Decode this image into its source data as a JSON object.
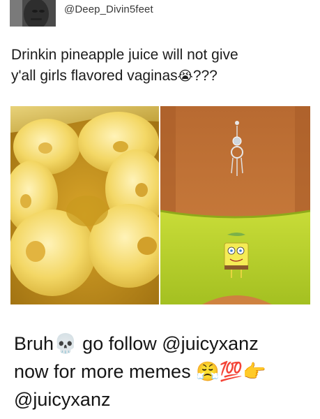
{
  "header": {
    "handle": "@Deep_Divin5feet"
  },
  "tweet": {
    "line1": "Drinkin pineapple juice will not give",
    "line2_text": "y'all girls flavored vaginas",
    "line2_emoji": "😭",
    "line2_suffix": "???"
  },
  "collage": {
    "left_image": "pineapple-rings-photo",
    "right_image": "navel-piercing-spongebob-underwear-photo"
  },
  "caption": {
    "line1_a": "Bruh",
    "line1_emoji": "💀",
    "line1_b": " go follow @juicyxanz",
    "line2_a": "now for more memes ",
    "line2_emojis": "😤💯👉",
    "line3": "@juicyxanz"
  },
  "colors": {
    "pineapple_yellow": "#f2d36a",
    "pineapple_juice": "#c99a1e",
    "skin": "#c8773a",
    "underwear_green": "#b7d22c",
    "text": "#1a1a1a"
  }
}
